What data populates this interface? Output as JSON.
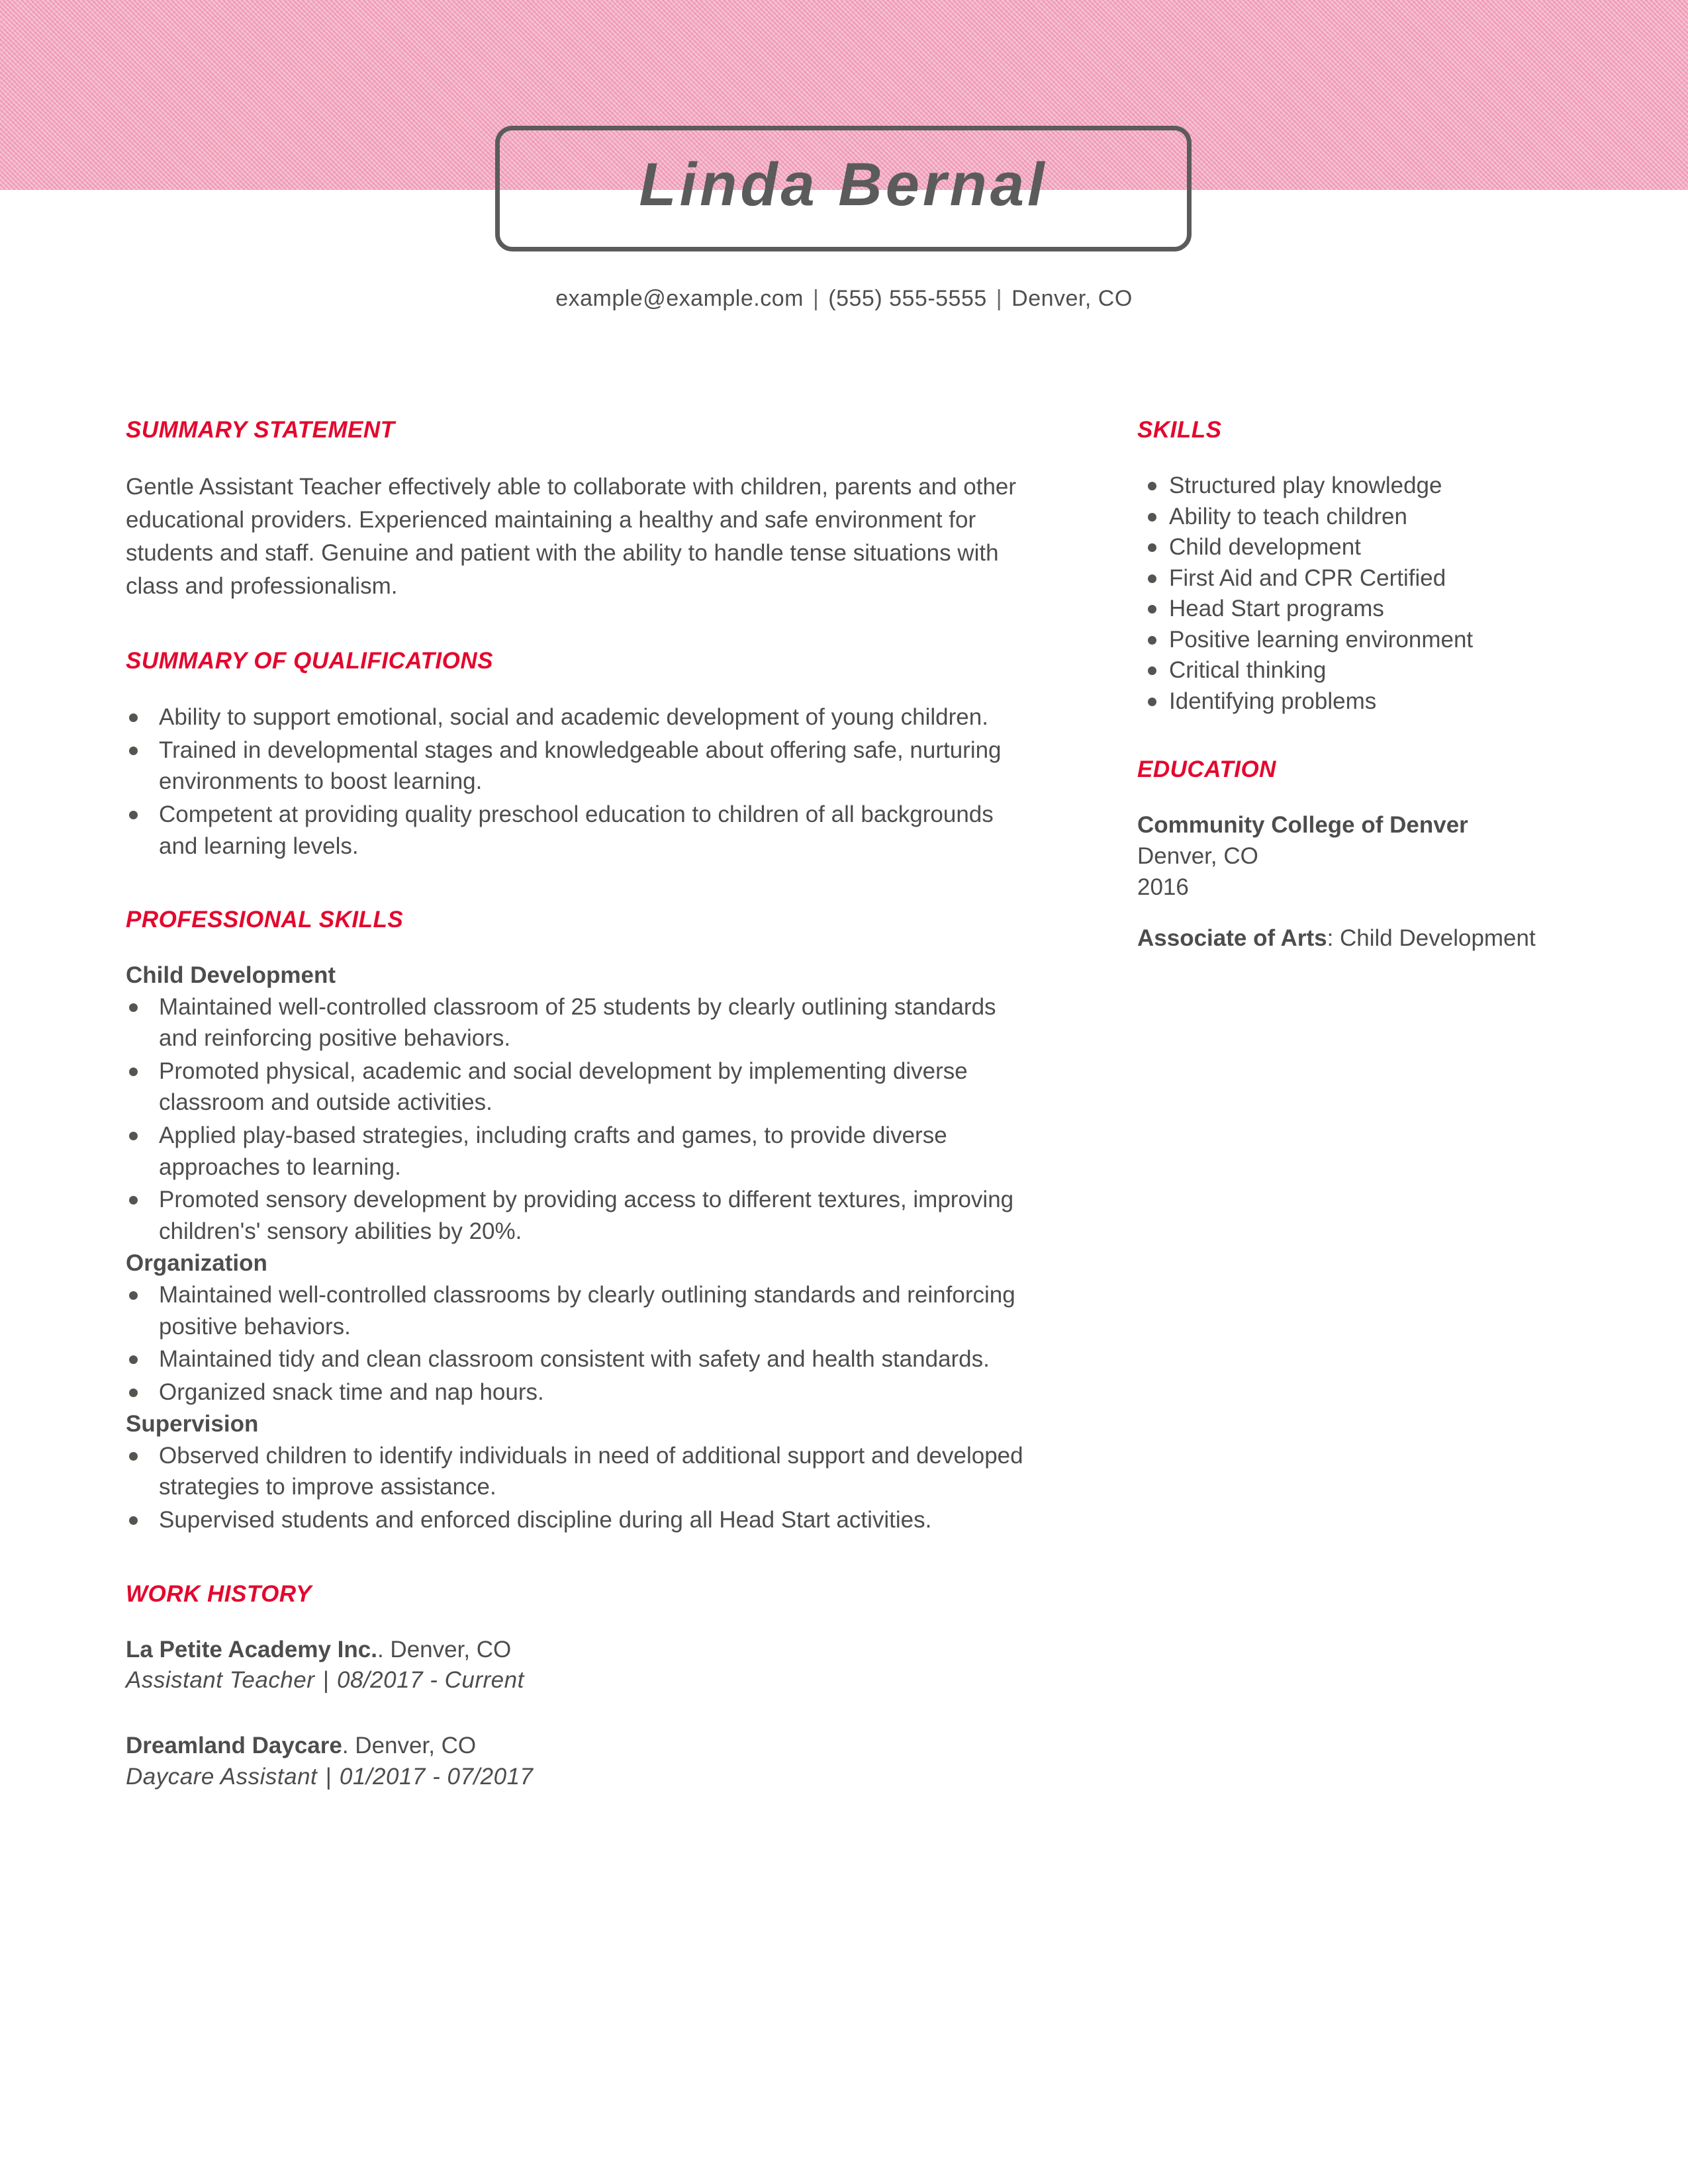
{
  "theme": {
    "accent_red": "#e4082e",
    "banner_pink": "#f6c2cf",
    "text_gray": "#4d4d4d"
  },
  "header": {
    "full_name": "Linda Bernal",
    "contact": {
      "email": "example@example.com",
      "phone": "(555) 555-5555",
      "location": "Denver, CO",
      "separator": "|"
    }
  },
  "left_column": {
    "summary_statement": {
      "title": "SUMMARY STATEMENT",
      "body": "Gentle Assistant Teacher effectively able to collaborate with children, parents and other educational providers. Experienced maintaining a healthy and safe environment for students and staff. Genuine and patient with the ability to handle tense situations with class and professionalism."
    },
    "summary_of_qualifications": {
      "title": "SUMMARY OF QUALIFICATIONS",
      "items": [
        "Ability to support emotional, social and academic development of young children.",
        "Trained in developmental stages and knowledgeable about offering safe, nurturing environments to boost learning.",
        "Competent at providing quality preschool education to children of all backgrounds and learning levels."
      ]
    },
    "professional_skills": {
      "title": "PROFESSIONAL SKILLS",
      "groups": [
        {
          "heading": "Child Development",
          "items": [
            "Maintained well-controlled classroom of 25 students by clearly outlining standards and reinforcing positive behaviors.",
            "Promoted physical, academic and social development by implementing diverse classroom and outside activities.",
            "Applied play-based strategies, including crafts and games, to provide diverse approaches to learning.",
            "Promoted sensory development by providing access to different textures, improving children's' sensory abilities by 20%."
          ]
        },
        {
          "heading": "Organization",
          "items": [
            "Maintained well-controlled classrooms by clearly outlining standards and reinforcing positive behaviors.",
            "Maintained tidy and clean classroom consistent with safety and health standards.",
            "Organized snack time and nap hours."
          ]
        },
        {
          "heading": "Supervision",
          "items": [
            "Observed children to identify individuals in need of additional support and developed strategies to improve assistance.",
            "Supervised students and enforced discipline during all Head Start activities."
          ]
        }
      ]
    },
    "work_history": {
      "title": "WORK HISTORY",
      "jobs": [
        {
          "employer": "La Petite Academy Inc.",
          "location": ". Denver, CO",
          "role": "Assistant Teacher",
          "separator": "|",
          "dates": "08/2017 - Current"
        },
        {
          "employer": "Dreamland Daycare",
          "location": ". Denver, CO",
          "role": "Daycare Assistant",
          "separator": "|",
          "dates": "01/2017 - 07/2017"
        }
      ]
    }
  },
  "right_column": {
    "skills": {
      "title": "SKILLS",
      "items": [
        "Structured play knowledge",
        "Ability to teach children",
        "Child development",
        "First Aid and CPR Certified",
        "Head Start programs",
        "Positive learning environment",
        "Critical thinking",
        "Identifying problems"
      ]
    },
    "education": {
      "title": "EDUCATION",
      "school": "Community College of Denver",
      "school_location": "Denver, CO",
      "year": "2016",
      "degree_label": "Associate of Arts",
      "degree_field": ": Child Development"
    }
  }
}
